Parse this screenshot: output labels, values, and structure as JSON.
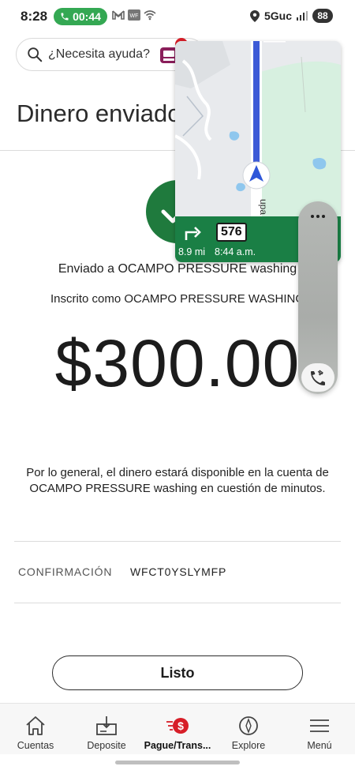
{
  "status_bar": {
    "time": "8:28",
    "call_timer": "00:44",
    "network": "5Guc",
    "battery": "88"
  },
  "search": {
    "placeholder": "¿Necesita ayuda?"
  },
  "page": {
    "title": "Dinero enviado"
  },
  "transfer": {
    "sent_to": "Enviado a OCAMPO PRESSURE washing",
    "enrolled_as": "Inscrito como OCAMPO PRESSURE WASHING",
    "amount": "$300.00",
    "availability_note": "Por lo general, el dinero estará disponible en la cuenta de OCAMPO PRESSURE washing en cuestión de minutos.",
    "confirmation_label": "CONFIRMACIÓN",
    "confirmation_code": "WFCT0YSLYMFP"
  },
  "actions": {
    "done_label": "Listo"
  },
  "bottom_nav": {
    "items": [
      {
        "label": "Cuentas",
        "icon": "home-icon"
      },
      {
        "label": "Deposite",
        "icon": "deposit-icon"
      },
      {
        "label": "Pague/Trans...",
        "icon": "pay-transfer-icon"
      },
      {
        "label": "Explore",
        "icon": "compass-icon"
      },
      {
        "label": "Menú",
        "icon": "menu-icon"
      }
    ],
    "active_index": 2
  },
  "map_overlay": {
    "route_number": "576",
    "distance": "8.9 mi",
    "eta": "8:44 a.m."
  },
  "colors": {
    "brand_red": "#d71e28",
    "success_green": "#1f7a3d",
    "nav_green": "#1a7f45",
    "call_green": "#34a853"
  }
}
